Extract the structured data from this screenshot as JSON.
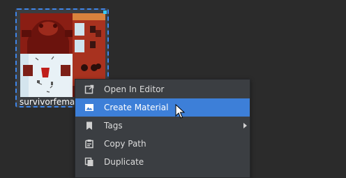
{
  "asset": {
    "name": "survivorfemalea..."
  },
  "context_menu": {
    "items": [
      {
        "label": "Open In Editor",
        "icon": "external-open-icon",
        "has_submenu": false
      },
      {
        "label": "Create Material",
        "icon": "image-icon",
        "has_submenu": false,
        "highlighted": true
      },
      {
        "label": "Tags",
        "icon": "bookmark-icon",
        "has_submenu": true
      },
      {
        "label": "Copy Path",
        "icon": "copy-path-icon",
        "has_submenu": false
      },
      {
        "label": "Duplicate",
        "icon": "duplicate-icon",
        "has_submenu": false
      }
    ]
  },
  "colors": {
    "background": "#2b2b2b",
    "menu_background": "#3b3e42",
    "highlight": "#3d7fd8",
    "selection_border": "#3f85e8"
  }
}
